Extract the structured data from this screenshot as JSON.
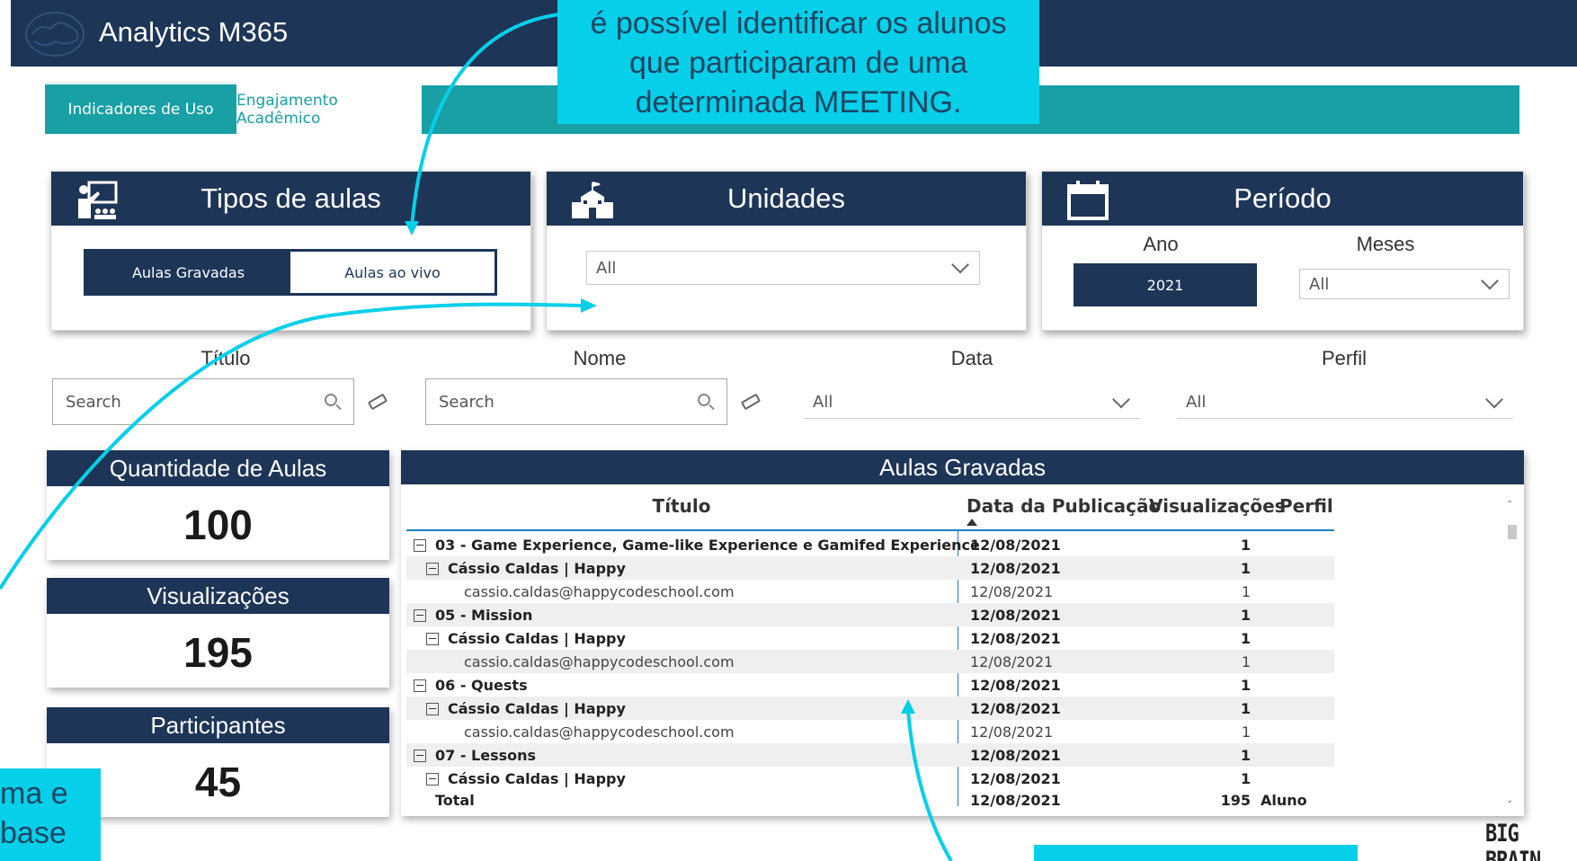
{
  "header": {
    "title": "Analytics M365"
  },
  "tabs": [
    {
      "label": "Indicadores de Uso",
      "active": true
    },
    {
      "label": "Engajamento Acadêmico",
      "active": false
    }
  ],
  "callouts": {
    "top": [
      "é possível identificar os alunos",
      "que participaram de uma",
      "determinada MEETING."
    ],
    "left": [
      "ma e",
      "base"
    ]
  },
  "filters": {
    "tipos": {
      "title": "Tipos de aulas",
      "options": [
        "Aulas Gravadas",
        "Aulas ao vivo"
      ],
      "selected": "Aulas Gravadas"
    },
    "unidades": {
      "title": "Unidades",
      "value": "All"
    },
    "periodo": {
      "title": "Período",
      "ano_label": "Ano",
      "ano_value": "2021",
      "meses_label": "Meses",
      "meses_value": "All"
    },
    "titulo": {
      "label": "Título",
      "placeholder": "Search"
    },
    "nome": {
      "label": "Nome",
      "placeholder": "Search"
    },
    "data": {
      "label": "Data",
      "value": "All"
    },
    "perfil": {
      "label": "Perfil",
      "value": "All"
    }
  },
  "kpis": [
    {
      "label": "Quantidade de Aulas",
      "value": "100"
    },
    {
      "label": "Visualizações",
      "value": "195"
    },
    {
      "label": "Participantes",
      "value": "45"
    }
  ],
  "table": {
    "title": "Aulas Gravadas",
    "columns": [
      "Título",
      "Data da Publicação",
      "Visualizações",
      "Perfil"
    ],
    "rows": [
      {
        "level": 0,
        "title": "03 - Game Experience, Game-like Experience e Gamifed Experience",
        "date": "12/08/2021",
        "views": "1",
        "perfil": ""
      },
      {
        "level": 1,
        "title": "Cássio Caldas | Happy",
        "date": "12/08/2021",
        "views": "1",
        "perfil": ""
      },
      {
        "level": 2,
        "title": "cassio.caldas@happycodeschool.com",
        "date": "12/08/2021",
        "views": "1",
        "perfil": ""
      },
      {
        "level": 0,
        "title": "05 - Mission",
        "date": "12/08/2021",
        "views": "1",
        "perfil": ""
      },
      {
        "level": 1,
        "title": "Cássio Caldas | Happy",
        "date": "12/08/2021",
        "views": "1",
        "perfil": ""
      },
      {
        "level": 2,
        "title": "cassio.caldas@happycodeschool.com",
        "date": "12/08/2021",
        "views": "1",
        "perfil": ""
      },
      {
        "level": 0,
        "title": "06 - Quests",
        "date": "12/08/2021",
        "views": "1",
        "perfil": ""
      },
      {
        "level": 1,
        "title": "Cássio Caldas | Happy",
        "date": "12/08/2021",
        "views": "1",
        "perfil": ""
      },
      {
        "level": 2,
        "title": "cassio.caldas@happycodeschool.com",
        "date": "12/08/2021",
        "views": "1",
        "perfil": ""
      },
      {
        "level": 0,
        "title": "07 - Lessons",
        "date": "12/08/2021",
        "views": "1",
        "perfil": ""
      },
      {
        "level": 1,
        "title": "Cássio Caldas | Happy",
        "date": "12/08/2021",
        "views": "1",
        "perfil": ""
      }
    ],
    "total": {
      "title": "Total",
      "date": "12/08/2021",
      "views": "195",
      "perfil": "Aluno"
    }
  },
  "footer": {
    "logo": "BIG BRAIN"
  },
  "colors": {
    "navy": "#1d3557",
    "teal": "#18a0a5",
    "cyan_callout": "#06cfe9",
    "arrow": "#06cfe9"
  }
}
